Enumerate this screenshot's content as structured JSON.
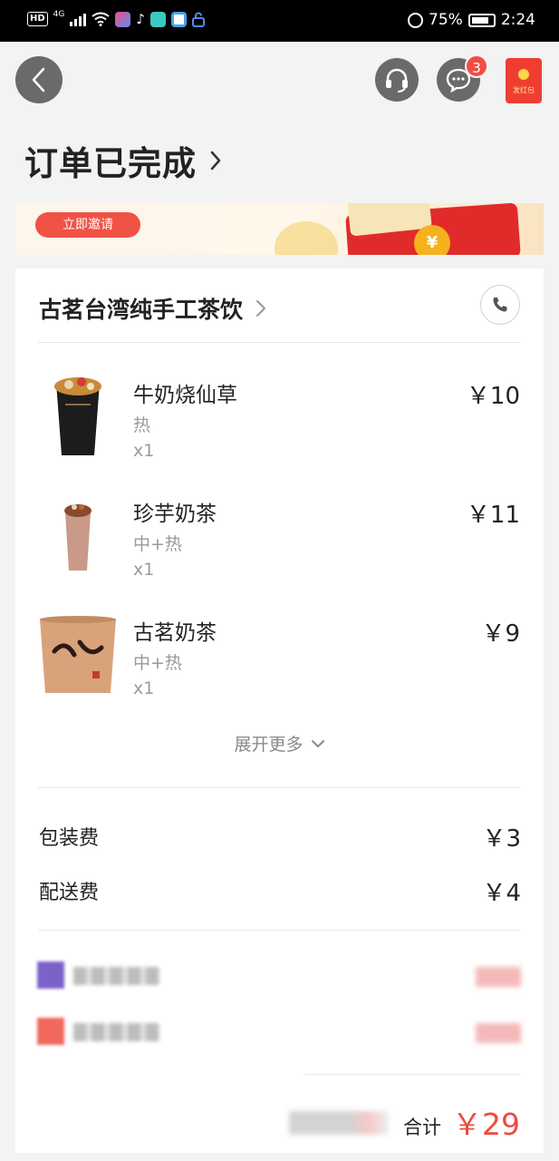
{
  "status_bar": {
    "hd": "HD",
    "network": "4G",
    "battery": "75%",
    "time": "2:24"
  },
  "nav": {
    "message_badge": "3",
    "red_packet_label": "发红包"
  },
  "page": {
    "title": "订单已完成"
  },
  "banner": {
    "invite_label": "立即邀请",
    "coin_symbol": "¥"
  },
  "store": {
    "name": "古茗台湾纯手工茶饮"
  },
  "items": [
    {
      "name": "牛奶烧仙草",
      "spec": "热",
      "qty": "x1",
      "price": "￥10"
    },
    {
      "name": "珍芋奶茶",
      "spec": "中+热",
      "qty": "x1",
      "price": "￥11"
    },
    {
      "name": "古茗奶茶",
      "spec": "中+热",
      "qty": "x1",
      "price": "￥9"
    }
  ],
  "expand_label": "展开更多",
  "fees": [
    {
      "label": "包装费",
      "amount": "￥3"
    },
    {
      "label": "配送费",
      "amount": "￥4"
    }
  ],
  "total": {
    "label": "合计",
    "amount": "￥29"
  },
  "colors": {
    "accent_red": "#f04a3e",
    "badge_red": "#f24d43",
    "nav_button_gray": "#6a6a6a",
    "background": "#f3f3f3"
  }
}
